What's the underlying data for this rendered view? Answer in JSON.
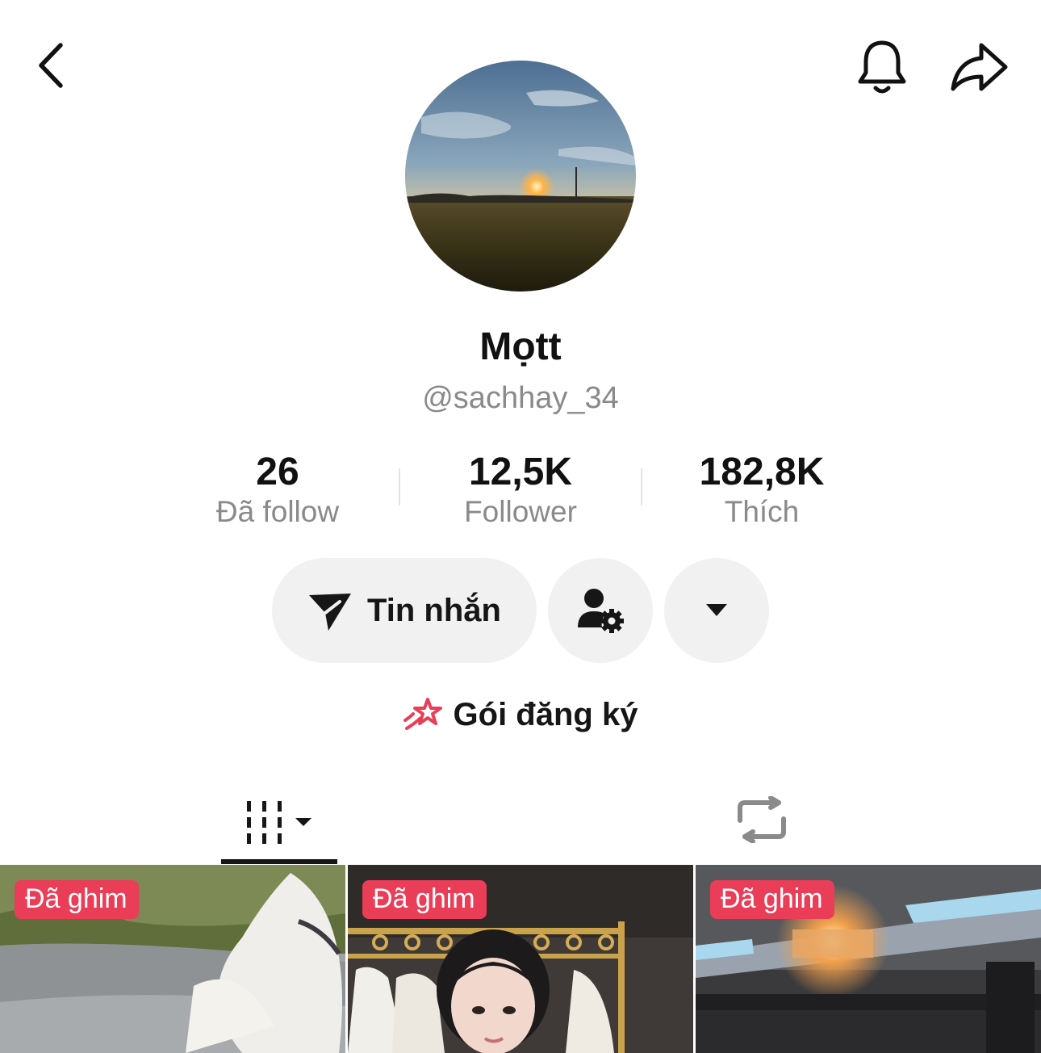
{
  "header": {
    "back_icon": "chevron-left-icon",
    "notification_icon": "bell-icon",
    "share_icon": "share-arrow-icon"
  },
  "profile": {
    "display_name": "Mọtt",
    "username": "@sachhay_34"
  },
  "stats": [
    {
      "value": "26",
      "label": "Đã follow"
    },
    {
      "value": "12,5K",
      "label": "Follower"
    },
    {
      "value": "182,8K",
      "label": "Thích"
    }
  ],
  "actions": {
    "message_label": "Tin nhắn",
    "message_icon": "send-icon",
    "friend_settings_icon": "user-gear-icon",
    "more_icon": "caret-down-icon"
  },
  "subscription": {
    "label": "Gói đăng ký",
    "icon": "shooting-star-icon",
    "accent": "#ea3d58"
  },
  "tabs": [
    {
      "name": "videos",
      "icon": "grid-bars-icon",
      "active": true
    },
    {
      "name": "reposts",
      "icon": "repost-icon",
      "active": false
    }
  ],
  "videos": [
    {
      "badge": "Đã ghim"
    },
    {
      "badge": "Đã ghim"
    },
    {
      "badge": "Đã ghim"
    }
  ]
}
